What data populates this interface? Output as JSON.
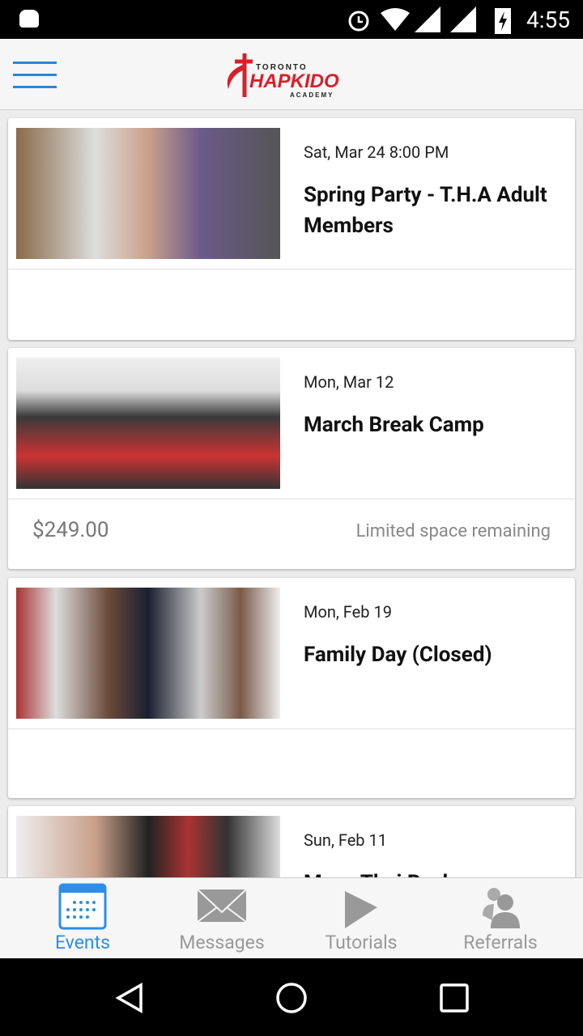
{
  "status_bar": {
    "time": "4:55"
  },
  "header": {
    "logo_text": "TORONTO HAPKIDO ACADEMY"
  },
  "events": [
    {
      "date": "Sat, Mar 24 8:00 PM",
      "title": "Spring Party - T.H.A Adult Members",
      "price": "",
      "availability": ""
    },
    {
      "date": "Mon, Mar 12",
      "title": "March Break Camp",
      "price": "$249.00",
      "availability": "Limited space remaining"
    },
    {
      "date": "Mon, Feb 19",
      "title": "Family Day (Closed)",
      "price": "",
      "availability": ""
    },
    {
      "date": "Sun, Feb 11",
      "title": "Muay Thai Bash",
      "price": "",
      "availability": ""
    }
  ],
  "bottom_nav": {
    "items": [
      {
        "label": "Events",
        "icon": "calendar-icon",
        "active": true
      },
      {
        "label": "Messages",
        "icon": "envelope-icon",
        "active": false
      },
      {
        "label": "Tutorials",
        "icon": "play-icon",
        "active": false
      },
      {
        "label": "Referrals",
        "icon": "users-icon",
        "active": false
      }
    ]
  },
  "colors": {
    "accent": "#2d8ee6",
    "logo_red": "#d8202a",
    "inactive": "#999999"
  }
}
